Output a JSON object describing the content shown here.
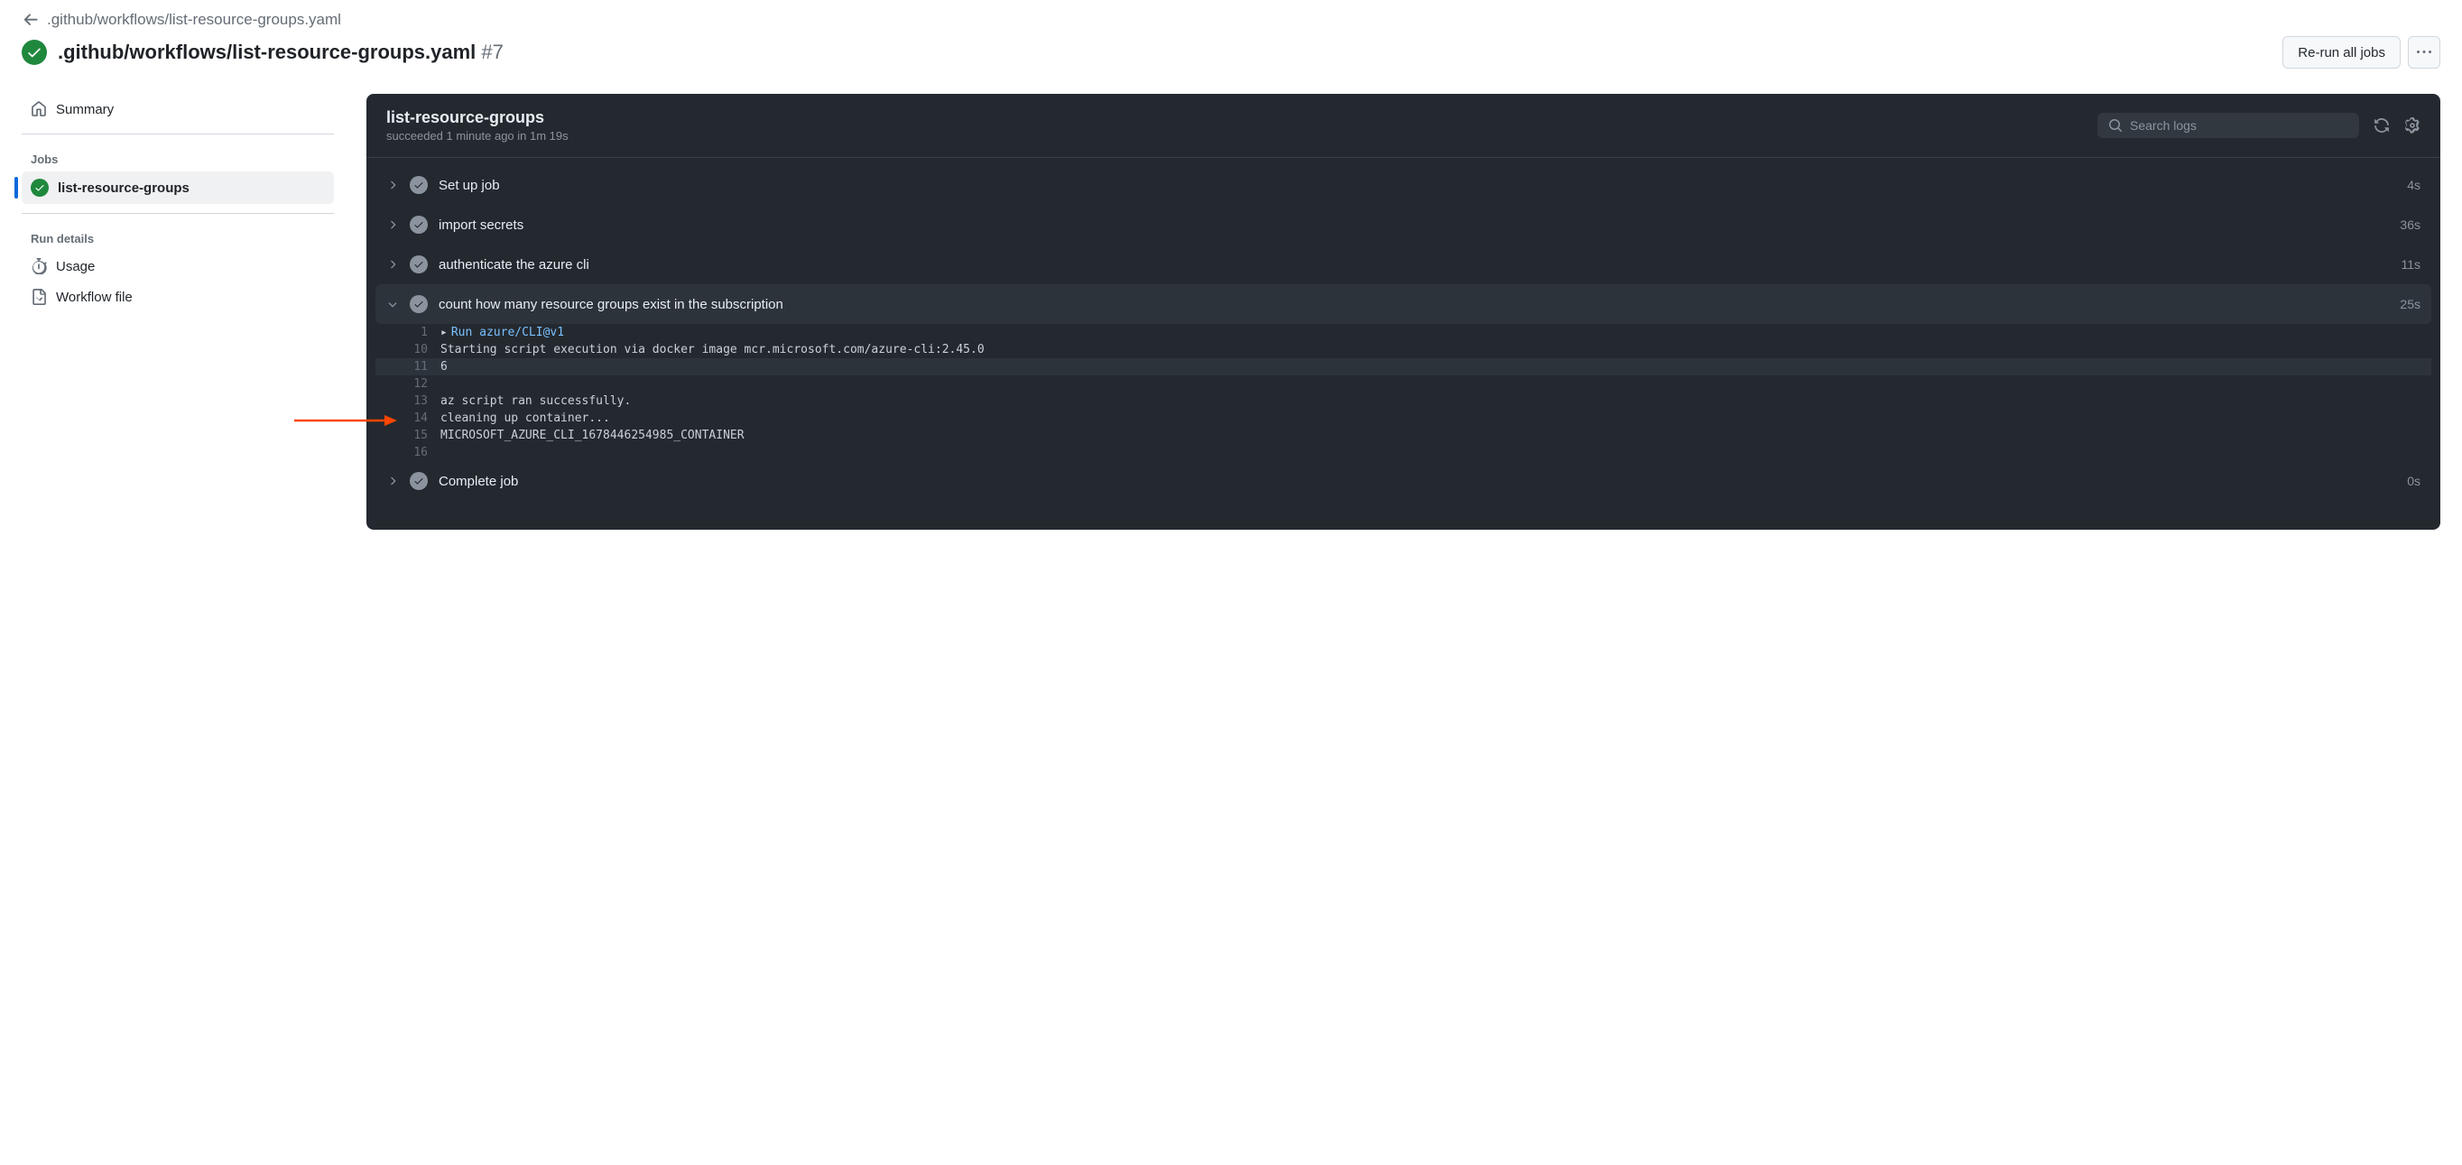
{
  "breadcrumb": ".github/workflows/list-resource-groups.yaml",
  "title": {
    "name": ".github/workflows/list-resource-groups.yaml",
    "run_number": "#7"
  },
  "actions": {
    "rerun_label": "Re-run all jobs"
  },
  "sidebar": {
    "summary_label": "Summary",
    "jobs_section": "Jobs",
    "jobs": [
      {
        "name": "list-resource-groups"
      }
    ],
    "run_details_section": "Run details",
    "usage_label": "Usage",
    "workflow_file_label": "Workflow file"
  },
  "job": {
    "title": "list-resource-groups",
    "subtitle": "succeeded 1 minute ago in 1m 19s",
    "search_placeholder": "Search logs"
  },
  "steps": [
    {
      "name": "Set up job",
      "duration": "4s",
      "expanded": false
    },
    {
      "name": "import secrets",
      "duration": "36s",
      "expanded": false
    },
    {
      "name": "authenticate the azure cli",
      "duration": "11s",
      "expanded": false
    },
    {
      "name": "count how many resource groups exist in the subscription",
      "duration": "25s",
      "expanded": true
    },
    {
      "name": "Complete job",
      "duration": "0s",
      "expanded": false
    }
  ],
  "log_lines": [
    {
      "n": "1",
      "text": "Run azure/CLI@v1",
      "cmd": true,
      "tri": true,
      "hl": false
    },
    {
      "n": "10",
      "text": "Starting script execution via docker image mcr.microsoft.com/azure-cli:2.45.0",
      "cmd": false,
      "tri": false,
      "hl": false
    },
    {
      "n": "11",
      "text": "6",
      "cmd": false,
      "tri": false,
      "hl": true
    },
    {
      "n": "12",
      "text": "",
      "cmd": false,
      "tri": false,
      "hl": false
    },
    {
      "n": "13",
      "text": "az script ran successfully.",
      "cmd": false,
      "tri": false,
      "hl": false
    },
    {
      "n": "14",
      "text": "cleaning up container...",
      "cmd": false,
      "tri": false,
      "hl": false
    },
    {
      "n": "15",
      "text": "MICROSOFT_AZURE_CLI_1678446254985_CONTAINER",
      "cmd": false,
      "tri": false,
      "hl": false
    },
    {
      "n": "16",
      "text": "",
      "cmd": false,
      "tri": false,
      "hl": false
    }
  ]
}
